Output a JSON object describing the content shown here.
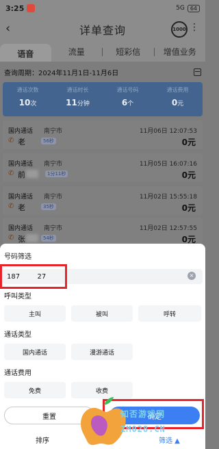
{
  "status": {
    "time": "3:25",
    "signal": "5G",
    "battery": "64"
  },
  "header": {
    "title": "详单查询",
    "service_icon_label": "1000"
  },
  "tabs": [
    {
      "label": "语音"
    },
    {
      "label": "流量"
    },
    {
      "label": "短彩信"
    },
    {
      "label": "增值业务"
    }
  ],
  "period": {
    "label": "查询周期：2024年11月1日-11月6日"
  },
  "summary": [
    {
      "label": "通话次数",
      "value": "10",
      "unit": "次"
    },
    {
      "label": "通话时长",
      "value": "11",
      "unit": "分钟"
    },
    {
      "label": "通话号码",
      "value": "6",
      "unit": "个"
    },
    {
      "label": "通话费用",
      "value": "0",
      "unit": "元"
    }
  ],
  "records": [
    {
      "type": "国内通话",
      "city": "南宁市",
      "datetime": "11月06日 12:07:53",
      "name": "老",
      "duration": "56秒",
      "cost": "0元"
    },
    {
      "type": "国内通话",
      "city": "南宁市",
      "datetime": "11月05日 16:07:16",
      "name": "前",
      "duration": "1分11秒",
      "cost": "0元"
    },
    {
      "type": "国内通话",
      "city": "南宁市",
      "datetime": "11月02日 15:55:18",
      "name": "老",
      "duration": "35秒",
      "cost": "0元"
    },
    {
      "type": "国内通话",
      "city": "南宁市",
      "datetime": "11月02日 12:57:55",
      "name": "张",
      "duration": "54秒",
      "cost": "0元"
    }
  ],
  "filter": {
    "number_title": "号码筛选",
    "number_value": "187        27",
    "call_type_title": "呼叫类型",
    "call_types": [
      "主叫",
      "被叫",
      "呼转"
    ],
    "comm_type_title": "通话类型",
    "comm_types": [
      "国内通话",
      "漫游通话"
    ],
    "fee_title": "通话费用",
    "fees": [
      "免费",
      "收费"
    ],
    "reset_label": "重置",
    "confirm_label": "确定"
  },
  "bottom": {
    "sort_label": "排序",
    "filter_label": "筛选 ▲"
  },
  "watermark": {
    "text": "知否游戏网",
    "url": "ZM028.CN"
  },
  "colors": {
    "accent": "#3b7ff2",
    "highlight": "#e8232a",
    "summary_bg": "#43648e"
  }
}
